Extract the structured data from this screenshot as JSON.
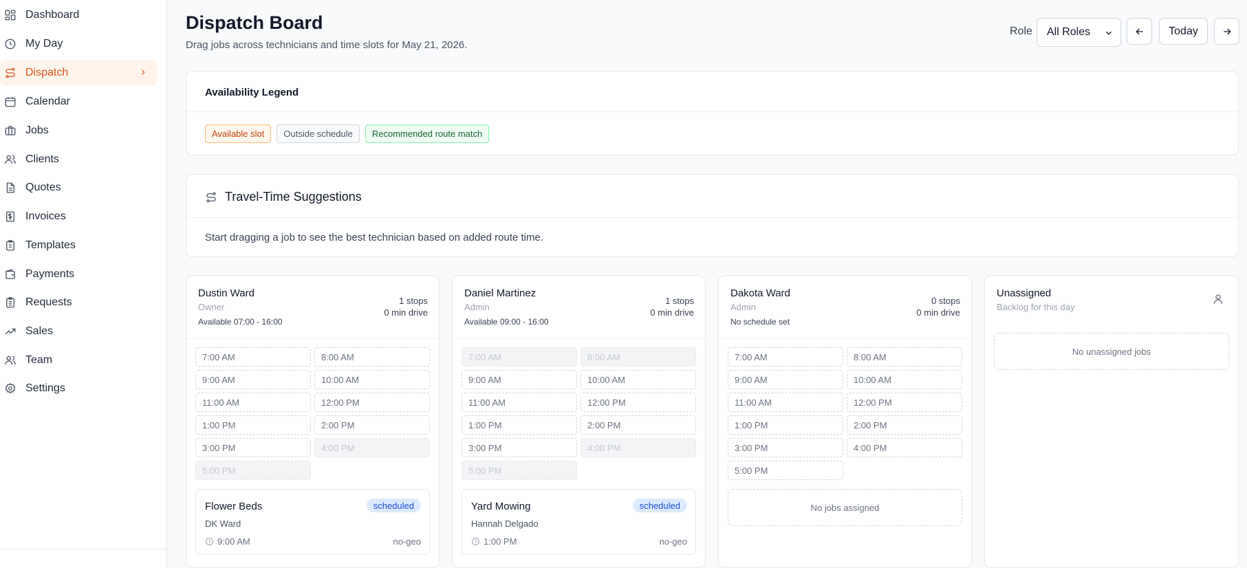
{
  "sidebar": {
    "items": [
      {
        "label": "Dashboard",
        "icon": "dashboard-icon"
      },
      {
        "label": "My Day",
        "icon": "clock-icon"
      },
      {
        "label": "Dispatch",
        "icon": "route-icon",
        "active": true
      },
      {
        "label": "Calendar",
        "icon": "calendar-icon"
      },
      {
        "label": "Jobs",
        "icon": "briefcase-icon"
      },
      {
        "label": "Clients",
        "icon": "users-icon"
      },
      {
        "label": "Quotes",
        "icon": "document-icon"
      },
      {
        "label": "Invoices",
        "icon": "invoice-icon"
      },
      {
        "label": "Templates",
        "icon": "clipboard-icon"
      },
      {
        "label": "Payments",
        "icon": "wallet-icon"
      },
      {
        "label": "Requests",
        "icon": "clipboard-list-icon"
      },
      {
        "label": "Sales",
        "icon": "trending-up-icon"
      },
      {
        "label": "Team",
        "icon": "team-icon"
      },
      {
        "label": "Settings",
        "icon": "gear-icon"
      }
    ]
  },
  "header": {
    "title": "Dispatch Board",
    "subtitle": "Drag jobs across technicians and time slots for May 21, 2026.",
    "role_label": "Role",
    "role_value": "All Roles",
    "today_label": "Today"
  },
  "legend": {
    "title": "Availability Legend",
    "badges": [
      "Available slot",
      "Outside schedule",
      "Recommended route match"
    ]
  },
  "travel": {
    "title": "Travel-Time Suggestions",
    "text": "Start dragging a job to see the best technician based on added route time."
  },
  "technicians": [
    {
      "name": "Dustin Ward",
      "role": "Owner",
      "availability": "Available 07:00 - 16:00",
      "stops": "1 stops",
      "drive": "0 min drive",
      "slots": [
        {
          "label": "7:00 AM",
          "available": true
        },
        {
          "label": "8:00 AM",
          "available": true
        },
        {
          "label": "9:00 AM",
          "available": true
        },
        {
          "label": "10:00 AM",
          "available": true
        },
        {
          "label": "11:00 AM",
          "available": true
        },
        {
          "label": "12:00 PM",
          "available": true
        },
        {
          "label": "1:00 PM",
          "available": true
        },
        {
          "label": "2:00 PM",
          "available": true
        },
        {
          "label": "3:00 PM",
          "available": true
        },
        {
          "label": "4:00 PM",
          "available": false
        },
        {
          "label": "5:00 PM",
          "available": false
        }
      ],
      "job": {
        "title": "Flower Beds",
        "status": "scheduled",
        "client": "DK Ward",
        "time": "9:00 AM",
        "geo": "no-geo"
      }
    },
    {
      "name": "Daniel Martinez",
      "role": "Admin",
      "availability": "Available 09:00 - 16:00",
      "stops": "1 stops",
      "drive": "0 min drive",
      "slots": [
        {
          "label": "7:00 AM",
          "available": false
        },
        {
          "label": "8:00 AM",
          "available": false
        },
        {
          "label": "9:00 AM",
          "available": true
        },
        {
          "label": "10:00 AM",
          "available": true
        },
        {
          "label": "11:00 AM",
          "available": true
        },
        {
          "label": "12:00 PM",
          "available": true
        },
        {
          "label": "1:00 PM",
          "available": true
        },
        {
          "label": "2:00 PM",
          "available": true
        },
        {
          "label": "3:00 PM",
          "available": true
        },
        {
          "label": "4:00 PM",
          "available": false
        },
        {
          "label": "5:00 PM",
          "available": false
        }
      ],
      "job": {
        "title": "Yard Mowing",
        "status": "scheduled",
        "client": "Hannah Delgado",
        "time": "1:00 PM",
        "geo": "no-geo"
      }
    },
    {
      "name": "Dakota Ward",
      "role": "Admin",
      "availability": "No schedule set",
      "stops": "0 stops",
      "drive": "0 min drive",
      "slots": [
        {
          "label": "7:00 AM",
          "available": true
        },
        {
          "label": "8:00 AM",
          "available": true
        },
        {
          "label": "9:00 AM",
          "available": true
        },
        {
          "label": "10:00 AM",
          "available": true
        },
        {
          "label": "11:00 AM",
          "available": true
        },
        {
          "label": "12:00 PM",
          "available": true
        },
        {
          "label": "1:00 PM",
          "available": true
        },
        {
          "label": "2:00 PM",
          "available": true
        },
        {
          "label": "3:00 PM",
          "available": true
        },
        {
          "label": "4:00 PM",
          "available": true
        },
        {
          "label": "5:00 PM",
          "available": true
        }
      ],
      "empty_text": "No jobs assigned"
    }
  ],
  "unassigned": {
    "title": "Unassigned",
    "subtitle": "Backlog for this day",
    "empty_text": "No unassigned jobs"
  },
  "colors": {
    "accent": "#d9531e",
    "accent_bg": "#fff4ec",
    "badge_blue_bg": "#dbeafe",
    "badge_blue_text": "#1d4ed8"
  }
}
